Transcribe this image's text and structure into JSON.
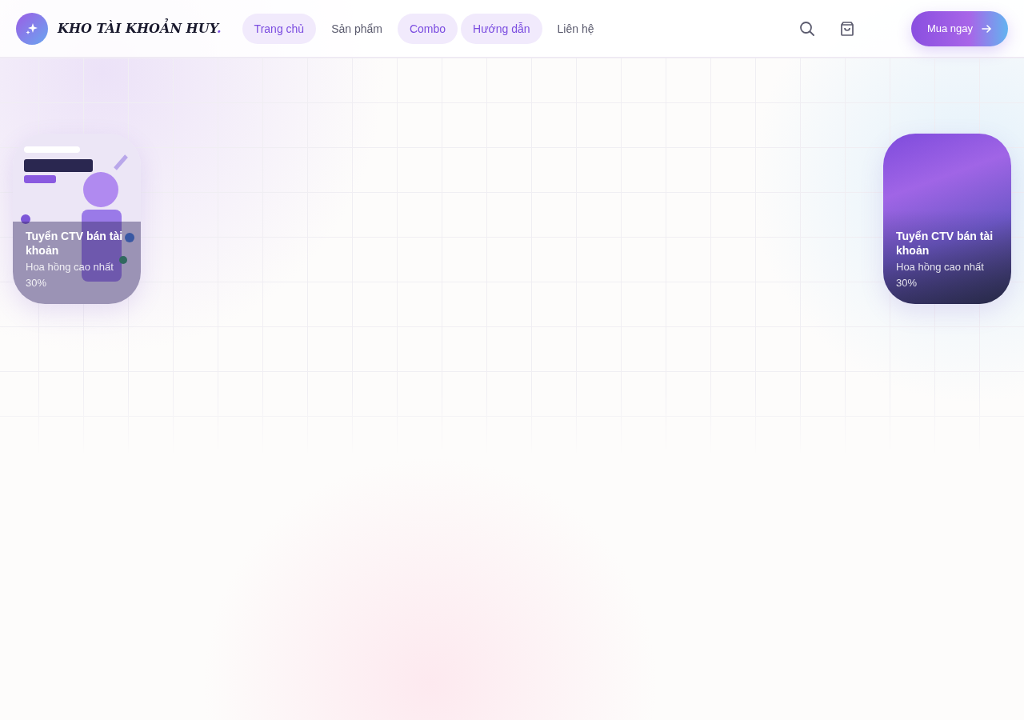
{
  "header": {
    "logo": "KHO TÀI KHOẢN HUY",
    "logo_dot": ".",
    "nav": [
      {
        "label": "Trang chủ",
        "selected": true
      },
      {
        "label": "Sản phẩm",
        "selected": false
      },
      {
        "label": "Combo",
        "selected": true
      },
      {
        "label": "Hướng dẫn",
        "selected": true
      },
      {
        "label": "Liên hệ",
        "selected": false
      }
    ],
    "cta": "Mua ngay"
  },
  "cards": [
    {
      "kind": "picture",
      "title": "Tuyển CTV bán tài khoản",
      "subtitle": "Hoa hồng cao nhất 30%"
    },
    {
      "kind": "gradient",
      "title": "Tuyển CTV bán tài khoản",
      "subtitle": "Hoa hồng cao nhất 30%"
    }
  ]
}
